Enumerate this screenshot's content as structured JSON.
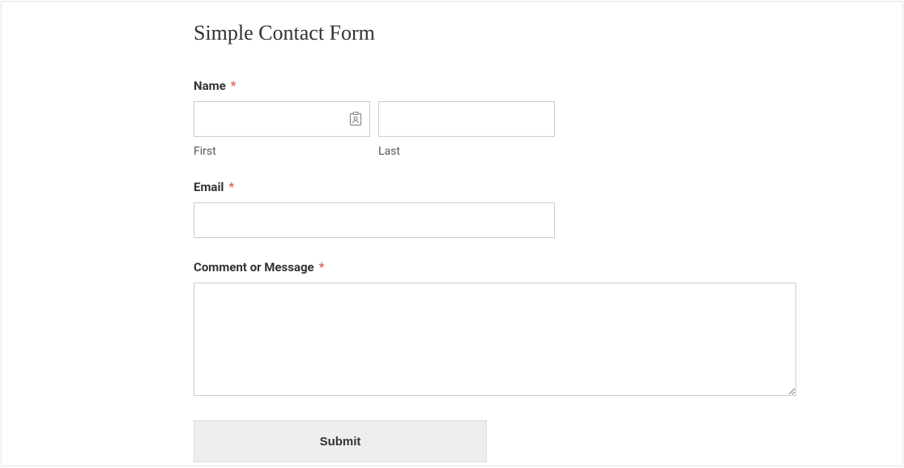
{
  "form": {
    "title": "Simple Contact Form",
    "name_label": "Name",
    "first_sublabel": "First",
    "last_sublabel": "Last",
    "first_value": "",
    "last_value": "",
    "email_label": "Email",
    "email_value": "",
    "message_label": "Comment or Message",
    "message_value": "",
    "submit_label": "Submit",
    "required_marker": "*"
  }
}
